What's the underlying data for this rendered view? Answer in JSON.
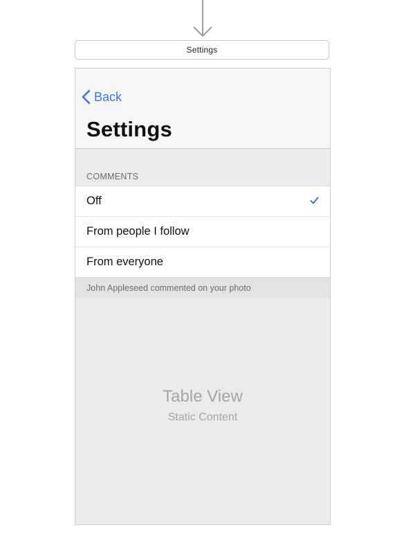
{
  "scene": {
    "label": "Settings"
  },
  "nav": {
    "back_label": "Back",
    "back_icon": "chevron-left-icon",
    "title": "Settings"
  },
  "table": {
    "section_header": "COMMENTS",
    "rows": [
      {
        "label": "Off",
        "checked": true
      },
      {
        "label": "From people I follow",
        "checked": false
      },
      {
        "label": "From everyone",
        "checked": false
      }
    ],
    "section_footer": "John Appleseed commented on your photo"
  },
  "placeholder": {
    "title": "Table View",
    "subtitle": "Static Content"
  },
  "colors": {
    "tint": "#3478f6",
    "nav_background": "#f7f7f7",
    "table_background": "#ebebeb",
    "secondary_text": "#6d6d72",
    "placeholder_text": "#a5a5a5"
  }
}
